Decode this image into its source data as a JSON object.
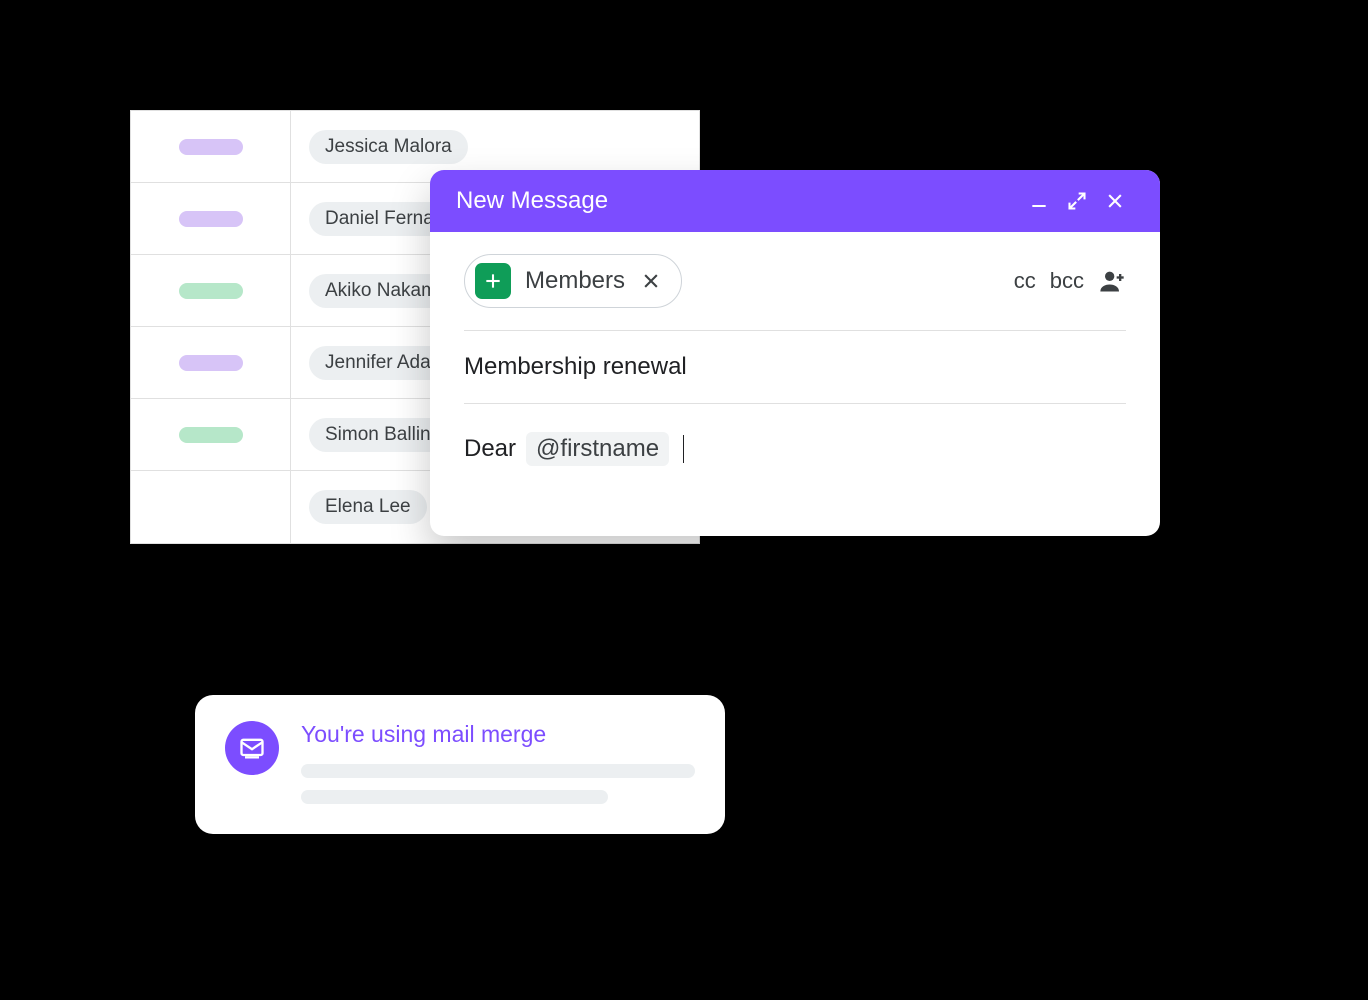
{
  "sheet": {
    "rows": [
      {
        "color": "lilac",
        "name": "Jessica Malora"
      },
      {
        "color": "lilac",
        "name": "Daniel Ferna"
      },
      {
        "color": "mint",
        "name": "Akiko Nakam"
      },
      {
        "color": "lilac",
        "name": "Jennifer Ada"
      },
      {
        "color": "mint",
        "name": "Simon Ballin"
      },
      {
        "color": "",
        "name": "Elena Lee"
      }
    ]
  },
  "compose": {
    "title": "New Message",
    "recipient_chip": "Members",
    "cc_label": "cc",
    "bcc_label": "bcc",
    "subject": "Membership renewal",
    "body_greeting": "Dear",
    "merge_tag": "@firstname"
  },
  "toast": {
    "title": "You're using mail merge"
  }
}
